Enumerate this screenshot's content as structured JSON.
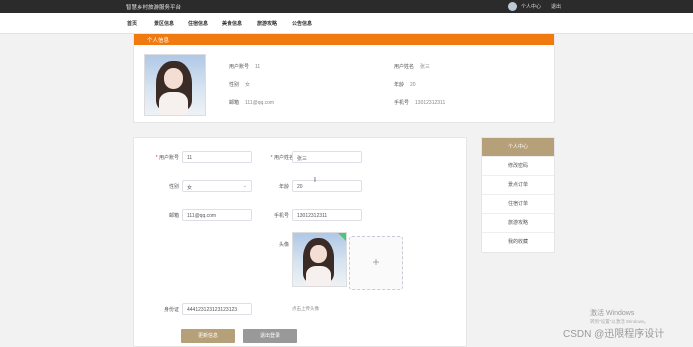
{
  "topbar": {
    "site_title": "智慧乡村旅游服务平台",
    "user_center": "个人中心",
    "logout": "退出"
  },
  "nav": {
    "items": [
      "首页",
      "景区信息",
      "住宿信息",
      "美食信息",
      "旅游攻略",
      "公告信息"
    ]
  },
  "profile_card": {
    "title": "个人信息",
    "account_label": "用户账号",
    "account_value": "11",
    "name_label": "用户姓名",
    "name_value": "张三",
    "gender_label": "性别",
    "gender_value": "女",
    "age_label": "年龄",
    "age_value": "20",
    "email_label": "邮箱",
    "email_value": "111@qq.com",
    "phone_label": "手机号",
    "phone_value": "13012312311"
  },
  "form": {
    "req_mark": "*",
    "account_label": "用户账号",
    "account_value": "11",
    "name_label": "用户姓名",
    "name_value": "张三",
    "gender_label": "性别",
    "gender_value": "女",
    "age_label": "年龄",
    "age_value": "20",
    "email_label": "邮箱",
    "email_value": "111@qq.com",
    "phone_label": "手机号",
    "phone_value": "13012312311",
    "avatar_label": "头像",
    "upload_plus": "+",
    "idcard_label": "身份证",
    "idcard_value": "444123123123123123",
    "avatar_hint": "点击上传头像",
    "update_button": "更新信息",
    "logout_button": "退出登录"
  },
  "side_menu": {
    "active": "个人中心",
    "items": [
      "修改密码",
      "景点订单",
      "住宿订单",
      "旅游攻略",
      "我的收藏"
    ]
  },
  "watermark": {
    "windows_title": "激活 Windows",
    "windows_sub": "转到\"设置\"以激活 Windows。",
    "csdn": "CSDN @迅限程序设计"
  },
  "colors": {
    "accent_orange": "#f07a10",
    "menu_active": "#b5a079",
    "button_primary": "#b5a079",
    "button_secondary": "#999999"
  }
}
